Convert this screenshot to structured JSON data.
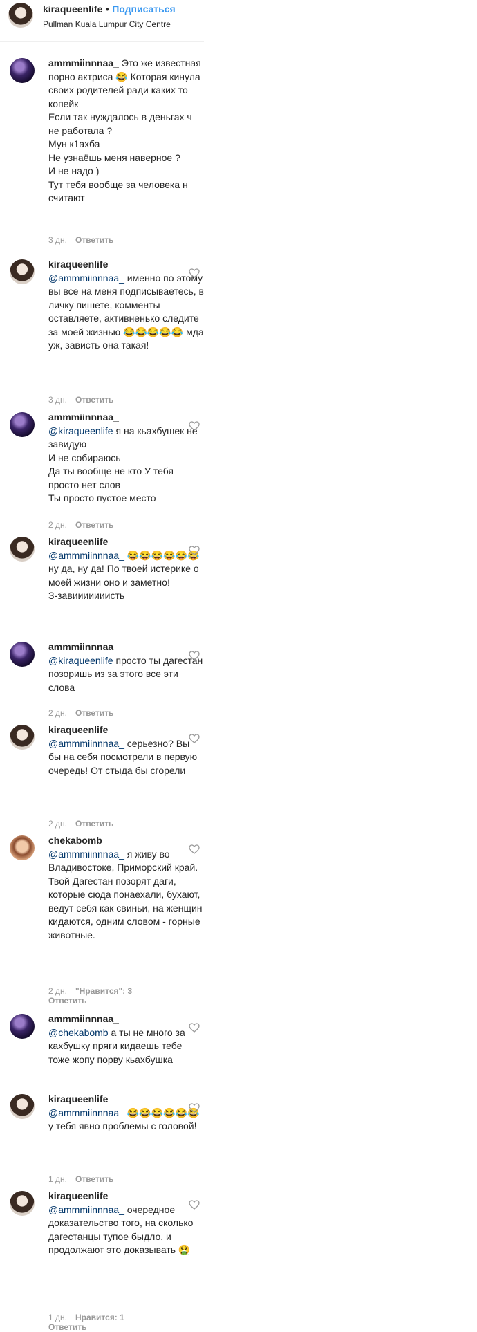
{
  "header": {
    "username": "kiraqueenlife",
    "separator": "•",
    "follow_label": "Подписаться",
    "location": "Pullman Kuala Lumpur City Centre"
  },
  "comments": [
    {
      "user": "ammmiinnnaa_",
      "text": " Это же известная порно актриса 😂 Которая кинула своих родителей ради каких то копейк\nЕсли так нуждалось в деньгах ч не работала ?\nМун к1ахба\nНе узнаёшь меня наверное ?\nИ не надо )\nТут тебя вообще за человека н считают",
      "time": "3 дн.",
      "reply": "Ответить"
    },
    {
      "user": "kiraqueenlife",
      "mention": "@ammmiinnnaa_",
      "text": " именно по этому вы все на меня подписываетесь, в личку пишете, комменты оставляете, активненько следите за моей жизнью 😂😂😂😂😂 мда уж, зависть она такая!",
      "time": "3 дн.",
      "reply": "Ответить"
    },
    {
      "user": "ammmiinnnaa_",
      "mention": "@kiraqueenlife",
      "text": " я на кьахбушек не завидую\nИ не собираюсь\nДа ты вообще не кто У тебя просто нет слов\nТы просто пустое место",
      "time": "2 дн.",
      "reply": "Ответить"
    },
    {
      "user": "kiraqueenlife",
      "mention": "@ammmiinnnaa_",
      "text": " 😂😂😂😂😂😂 ну да, ну да! По твоей истерике о моей жизни оно и заметно!\nЗ-завииииииисть"
    },
    {
      "user": "ammmiinnnaa_",
      "mention": "@kiraqueenlife",
      "text": " просто ты дагестан позоришь из за этого все эти слова",
      "time": "2 дн.",
      "reply": "Ответить"
    },
    {
      "user": "kiraqueenlife",
      "mention": "@ammmiinnnaa_",
      "text": " серьезно? Вы бы на себя посмотрели в первую очередь! От стыда бы сгорели",
      "time": "2 дн.",
      "reply": "Ответить"
    },
    {
      "user": "chekabomb",
      "mention": "@ammmiinnnaa_",
      "text": " я живу во Владивостоке, Приморский край. Твой Дагестан позорят даги, которые сюда понаехали, бухают, ведут себя как свиньи, на женщин кидаются, одним словом - горные животные.",
      "time": "2 дн.",
      "likes": "\"Нравится\": 3",
      "reply": "Ответить"
    },
    {
      "user": "ammmiinnnaa_",
      "mention": "@chekabomb",
      "text": " а ты не много за кахбушку пряги кидаешь тебе тоже жопу порву кьахбушка"
    },
    {
      "user": "kiraqueenlife",
      "mention": "@ammmiinnnaa_",
      "text": " 😂😂😂😂😂😂 у тебя явно проблемы с головой!",
      "time": "1 дн.",
      "reply": "Ответить"
    },
    {
      "user": "kiraqueenlife",
      "mention": "@ammmiinnnaa_",
      "text": " очередное доказательство того, на сколько дагестанцы тупое быдло, и продолжают это доказывать 🤮",
      "time": "1 дн.",
      "likes": "Нравится: 1",
      "reply": "Ответить"
    }
  ]
}
